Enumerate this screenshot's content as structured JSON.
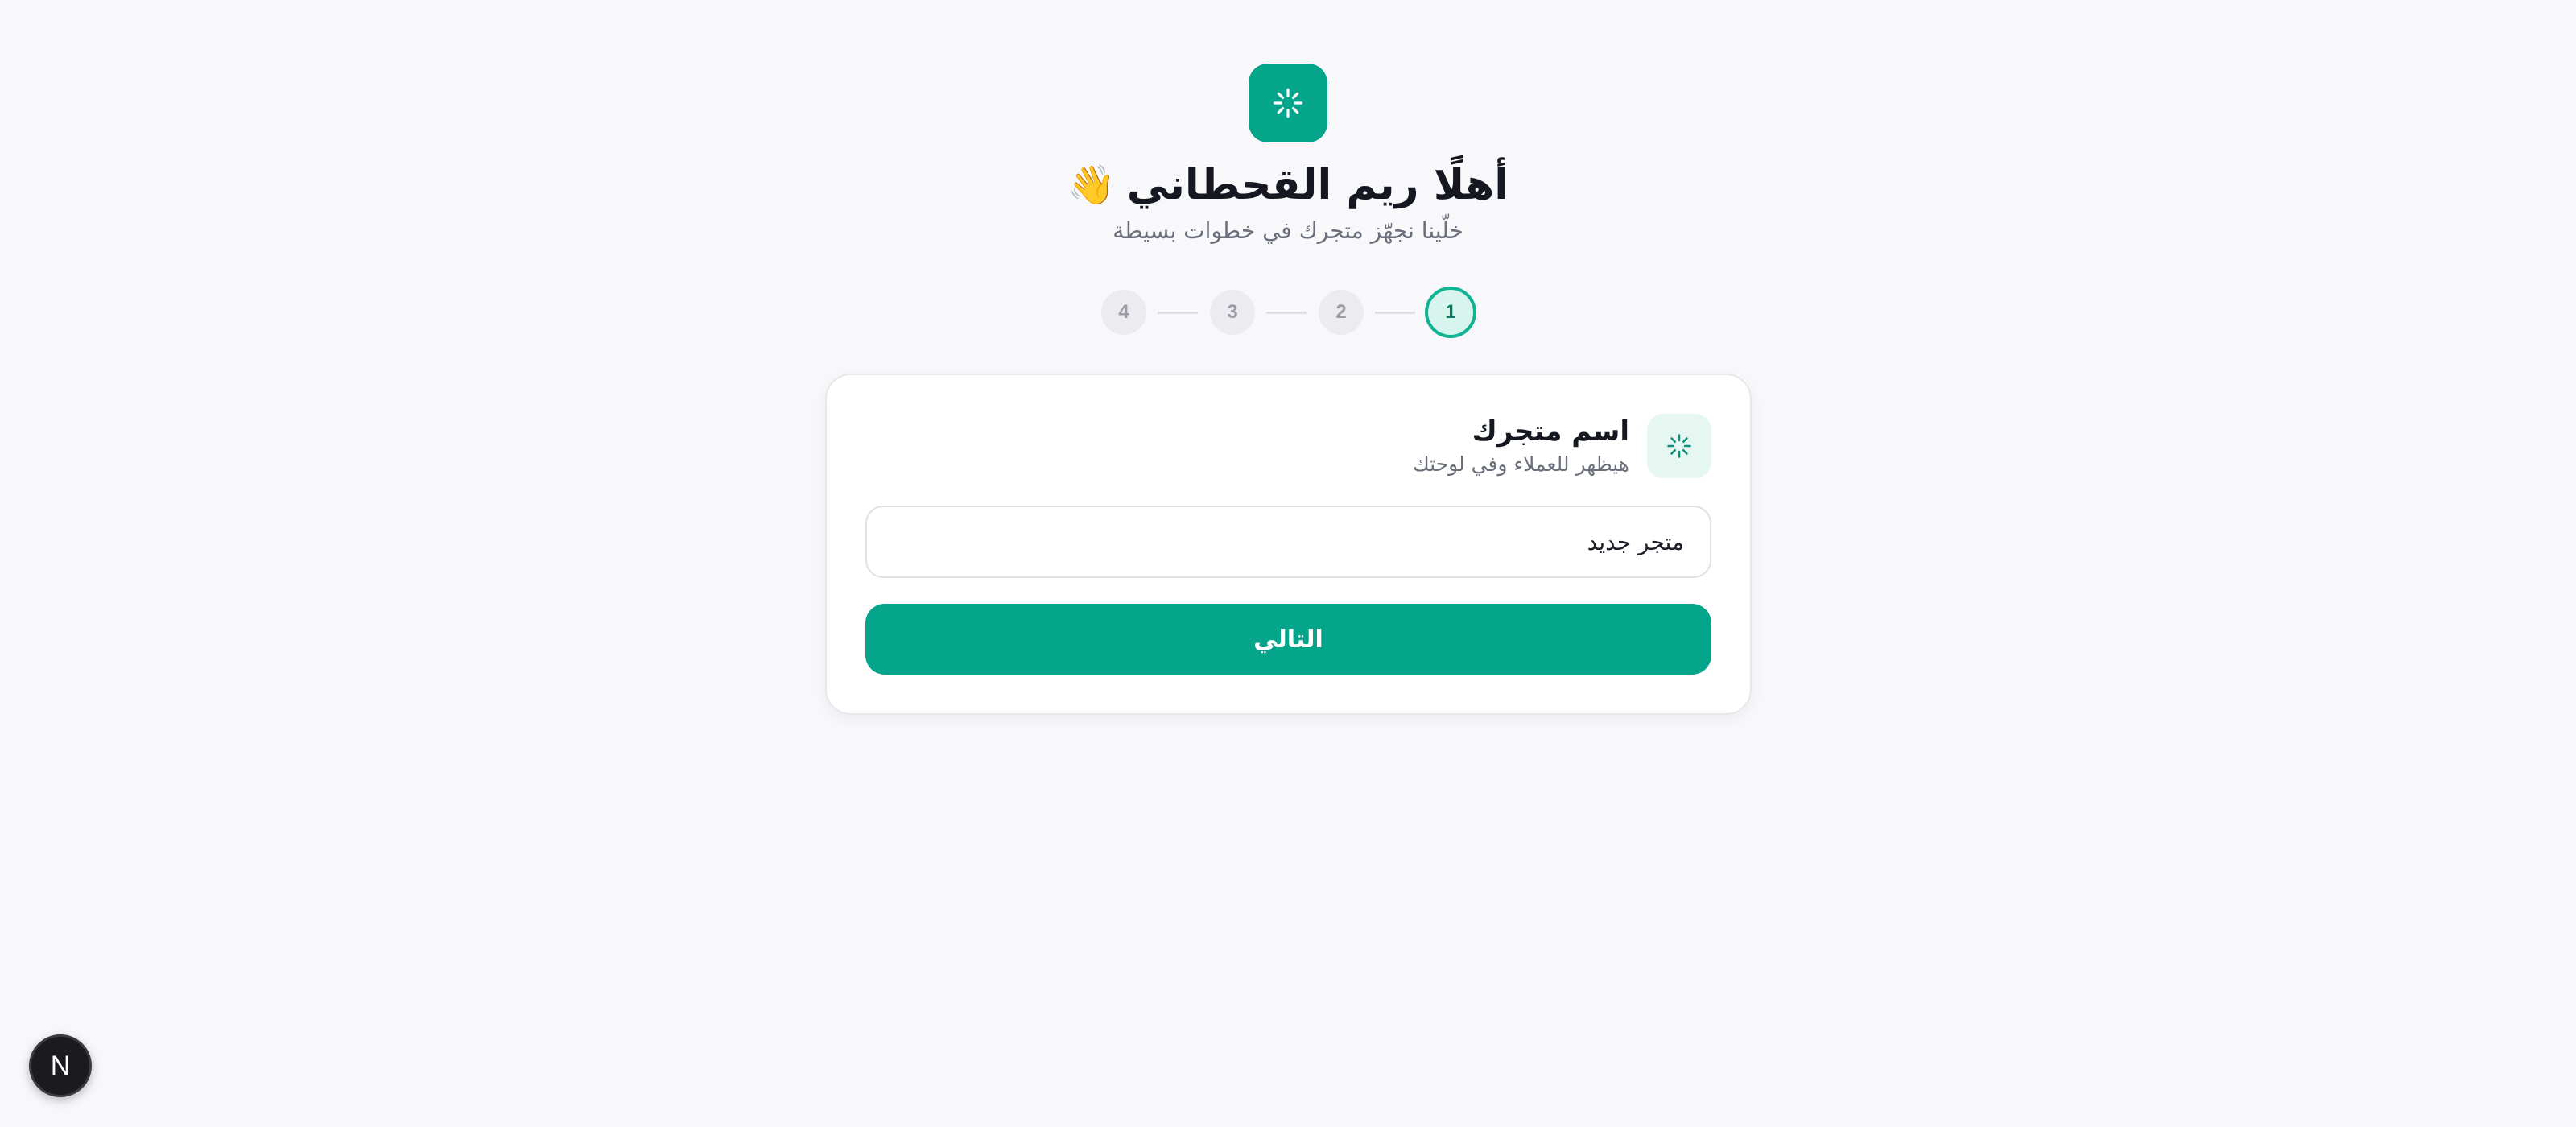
{
  "header": {
    "logo_icon": "loader-sparkle-icon",
    "greeting": "أهلًا ريم القحطاني",
    "greeting_emoji": "👋",
    "subtitle": "خلّينا نجهّز متجرك في خطوات بسيطة"
  },
  "stepper": {
    "current": 1,
    "steps": [
      "1",
      "2",
      "3",
      "4"
    ]
  },
  "store_step": {
    "icon": "loader-sparkle-icon",
    "title": "اسم متجرك",
    "description": "هيظهر للعملاء وفي لوحتك",
    "input_value": "متجر جديد",
    "next_label": "التالي"
  },
  "dev_badge": {
    "label": "N"
  },
  "colors": {
    "accent": "#05a58b",
    "accent_light": "#e6f7f2",
    "background": "#f8f8fb"
  }
}
